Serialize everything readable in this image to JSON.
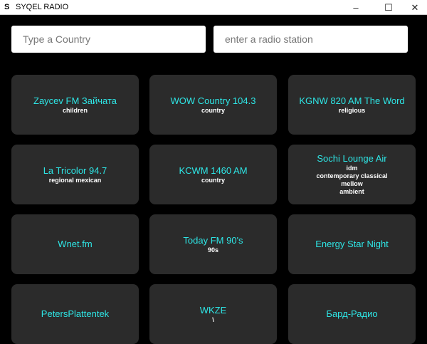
{
  "window": {
    "logo": "S",
    "title": "SYQEL RADIO",
    "minimize": "–",
    "maximize": "☐",
    "close": "✕"
  },
  "search": {
    "country_placeholder": "Type a Country",
    "station_placeholder": "enter a radio station"
  },
  "stations": [
    {
      "name": "Zaycev FM Зайчата",
      "genres": [
        "children"
      ]
    },
    {
      "name": "WOW Country 104.3",
      "genres": [
        "country"
      ]
    },
    {
      "name": "KGNW 820 AM The Word",
      "genres": [
        "religious"
      ]
    },
    {
      "name": "La Tricolor 94.7",
      "genres": [
        "regional mexican"
      ]
    },
    {
      "name": "KCWM 1460 AM",
      "genres": [
        "country"
      ]
    },
    {
      "name": "Sochi Lounge Air",
      "genres": [
        "idm",
        "contemporary classical",
        "mellow",
        "ambient"
      ]
    },
    {
      "name": "Wnet.fm",
      "genres": []
    },
    {
      "name": "Today FM 90's",
      "genres": [
        "90s"
      ]
    },
    {
      "name": "Energy Star Night",
      "genres": []
    },
    {
      "name": "PetersPlattentek",
      "genres": []
    },
    {
      "name": "WKZE",
      "genres": [
        "\\"
      ]
    },
    {
      "name": "Бард-Радио",
      "genres": []
    }
  ]
}
